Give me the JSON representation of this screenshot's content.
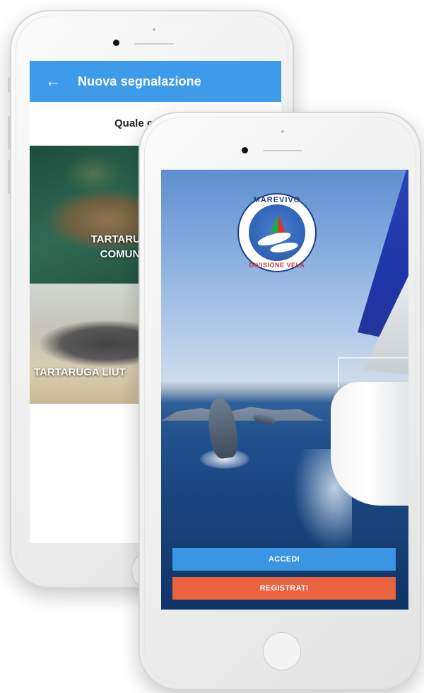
{
  "back_phone": {
    "app_bar": {
      "back_icon": "arrow-left-icon",
      "title": "Nuova segnalazione",
      "color": "#3d9be9"
    },
    "question_prefix": "Quale",
    "question_partial": "c",
    "options": [
      {
        "label_line1": "TARTARUGA",
        "label_line2": "COMUNE"
      },
      {
        "label": "TARTARUGA LIUT"
      }
    ]
  },
  "front_phone": {
    "logo": {
      "top_text": "MAREVIVO",
      "bottom_text": "DIVISIONE VELA"
    },
    "buttons": {
      "login_label": "ACCEDI",
      "register_label": "REGISTRATI",
      "login_color": "#3b95e3",
      "register_color": "#e8633e"
    }
  }
}
